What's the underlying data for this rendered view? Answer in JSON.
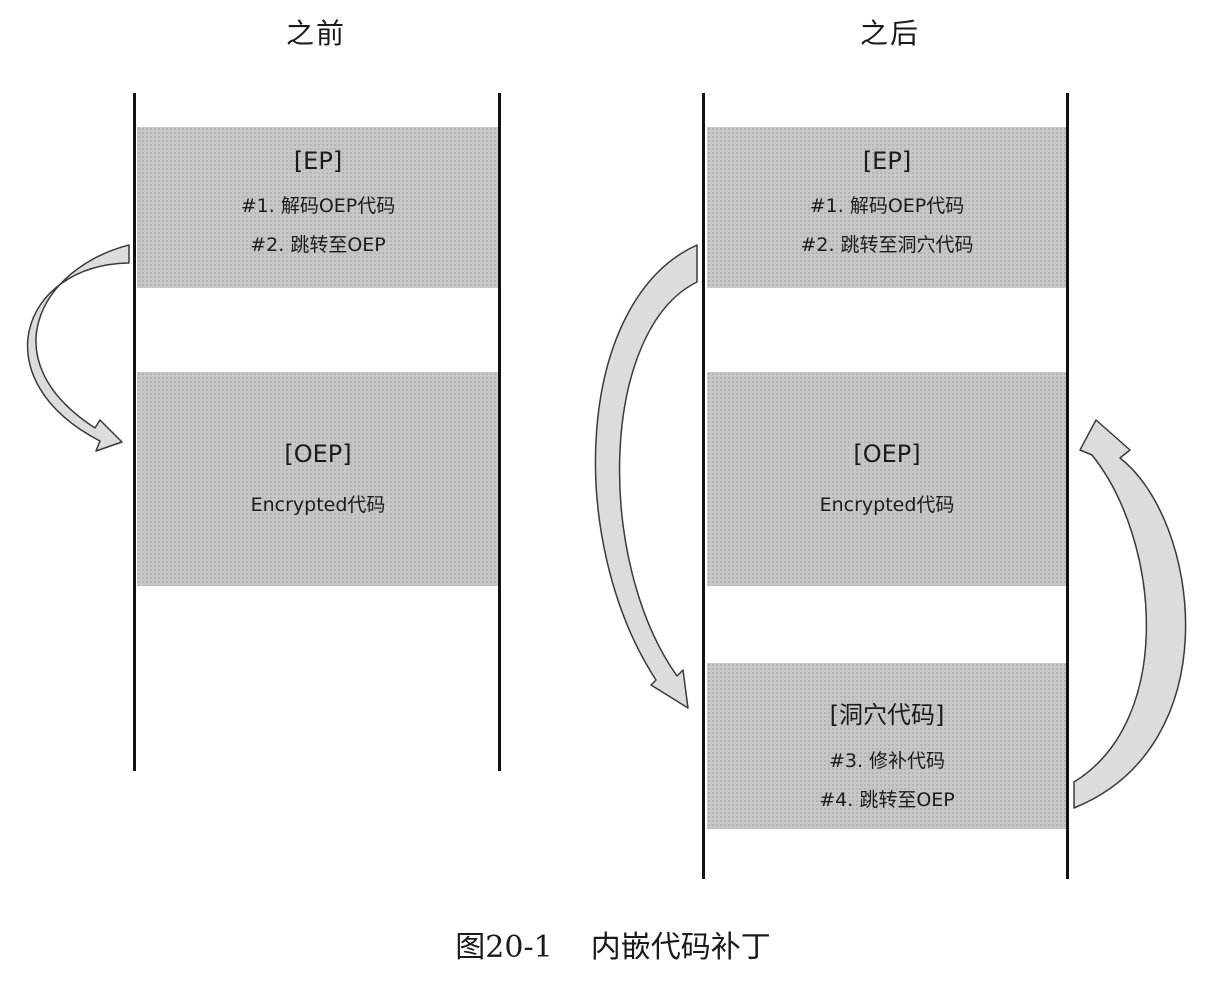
{
  "headings": {
    "before": "之前",
    "after": "之后"
  },
  "before": {
    "ep": {
      "title": "[EP]",
      "line1": "#1. 解码OEP代码",
      "line2": "#2. 跳转至OEP"
    },
    "oep": {
      "title": "[OEP]",
      "line1": "Encrypted代码"
    }
  },
  "after": {
    "ep": {
      "title": "[EP]",
      "line1": "#1. 解码OEP代码",
      "line2": "#2. 跳转至洞穴代码"
    },
    "oep": {
      "title": "[OEP]",
      "line1": "Encrypted代码"
    },
    "cave": {
      "title": "[洞穴代码]",
      "line1": "#3. 修补代码",
      "line2": "#4. 跳转至OEP"
    }
  },
  "caption": {
    "figure": "图20-1",
    "text": "内嵌代码补丁"
  },
  "colors": {
    "block_fill": "#c7c7c7",
    "arrow_fill": "#dcdcdc",
    "border": "#111111"
  }
}
